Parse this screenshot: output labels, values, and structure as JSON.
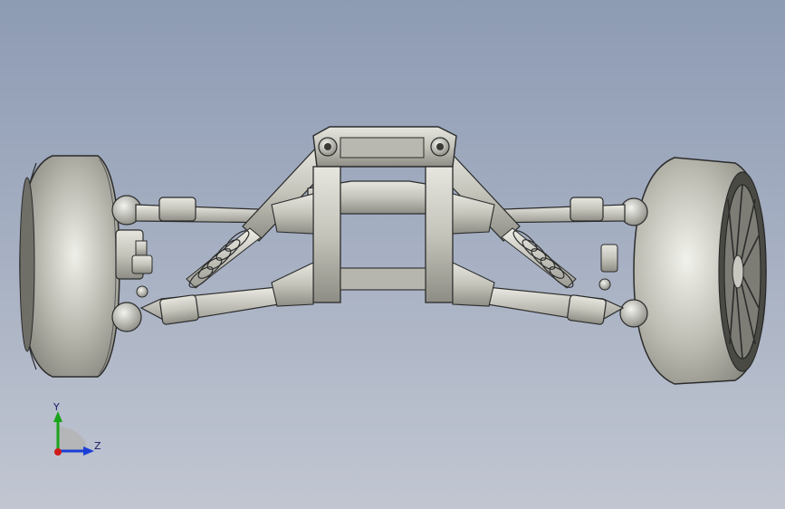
{
  "viewport": {
    "background_top": "#8d9bb3",
    "background_bottom": "#c1c6d1"
  },
  "model": {
    "part_color": "#c9c9c1",
    "edge_color": "#2b2b2b",
    "tire_color": "#bfbfb5"
  },
  "triad": {
    "y_label": "Y",
    "z_label": "Z",
    "y_color": "#1aa31a",
    "z_color": "#1a3fd6",
    "x_color": "#d11a1a"
  }
}
